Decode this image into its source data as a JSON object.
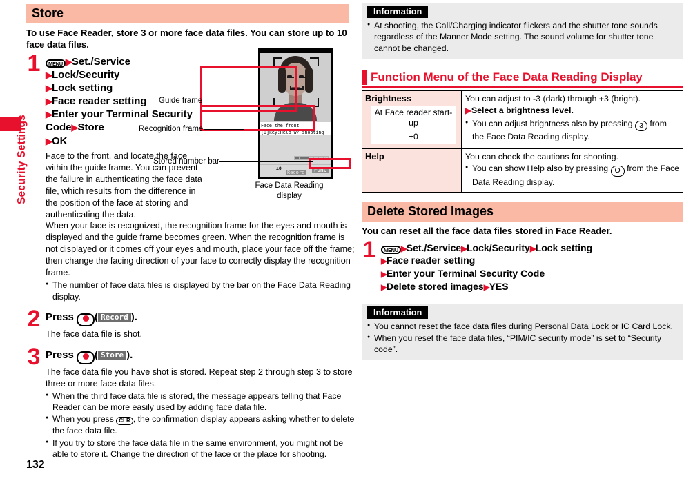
{
  "sidebar": {
    "chapter_label": "Security Settings"
  },
  "page": {
    "number": "132"
  },
  "left": {
    "section_title": "Store",
    "lead": "To use Face Reader, store 3 or more face data files. You can store up to 10 face data files.",
    "step1": {
      "num": "1",
      "menu_key": "MENU",
      "lines": [
        "Set./Service",
        "Lock/Security",
        "Lock setting",
        "Face reader setting",
        "Enter your Terminal Security Code",
        "Store",
        "OK"
      ],
      "body1": "Face to the front, and locate the face within the guide frame. You can prevent the failure in authenticating the face data file, which results from the difference in the position of the face at storing and authenticating the data.",
      "body2": "When your face is recognized, the recognition frame for the eyes and mouth is displayed and the guide frame becomes green. When the recognition frame is not displayed or it comes off your eyes and mouth, place your face off the frame; then change the facing direction of your face to correctly display the recognition frame.",
      "bullets": [
        "The number of face data files is displayed by the bar on the Face Data Reading display."
      ]
    },
    "step2": {
      "num": "2",
      "press_label": "Press",
      "softkey": "Record",
      "period": ").",
      "open_paren": "(",
      "body": "The face data file is shot."
    },
    "step3": {
      "num": "3",
      "press_label": "Press",
      "softkey": "Store",
      "body": "The face data file you have shot is stored. Repeat step 2 through step 3 to store three or more face data files.",
      "bullets": [
        "When the third face data file is stored, the message appears telling that Face Reader can be more easily used by adding face data file.",
        "When you press CLR , the confirmation display appears asking whether to delete the face data file.",
        "If you try to store the face data file in the same environment, you might not be able to store it. Change the direction of the face or the place for shooting."
      ],
      "bullet2_pre": "When you press",
      "bullet2_key": "CLR",
      "bullet2_post": ", the confirmation display appears asking whether to delete the face data file."
    },
    "figure": {
      "caption": "Face Data Reading display",
      "callouts": {
        "guide_frame": "Guide frame",
        "recognition_frame": "Recognition frame",
        "stored_number_bar": "Stored number bar"
      },
      "screen": {
        "line1": "Face the front",
        "line2": "[0]key:Help w/ shooting",
        "brightness": "±0",
        "record_softkey": "Record",
        "func_softkey": "FUNC",
        "stored_segments_filled": 3,
        "stored_segments_total": 10
      }
    }
  },
  "right": {
    "info_top": {
      "header": "Information",
      "bullets": [
        "At shooting, the Call/Charging indicator flickers and the shutter tone sounds regardless of the Manner Mode setting. The sound volume for shutter tone cannot be changed."
      ]
    },
    "function_menu": {
      "heading": "Function Menu of the Face Data Reading Display",
      "rows": [
        {
          "label": "Brightness",
          "default_title": "At Face reader start-up",
          "default_value": "±0",
          "desc_line1": "You can adjust to -3 (dark) through +3 (bright).",
          "sub_action": "Select a brightness level.",
          "bullet_pre": "You can adjust brightness also by pressing",
          "bullet_key": "3",
          "bullet_post": "from the Face Data Reading display."
        },
        {
          "label": "Help",
          "default_title": "",
          "default_value": "",
          "desc_line1": "You can check the cautions for shooting.",
          "sub_action": "",
          "bullet_pre": "You can show Help also by pressing",
          "bullet_key": "O",
          "bullet_post": "from the Face Data Reading display."
        }
      ]
    },
    "delete_section": {
      "section_title": "Delete Stored Images",
      "lead": "You can reset all the face data files stored in Face Reader.",
      "step1": {
        "num": "1",
        "menu_key": "MENU",
        "lines": [
          "Set./Service",
          "Lock/Security",
          "Lock setting",
          "Face reader setting",
          "Enter your Terminal Security Code",
          "Delete stored images",
          "YES"
        ]
      }
    },
    "info_bottom": {
      "header": "Information",
      "bullets": [
        "You cannot reset the face data files during Personal Data Lock or IC Card Lock.",
        "When you reset the face data files, “PIM/IC security mode” is set to “Security code”."
      ]
    }
  },
  "colors": {
    "accent_red": "#e8112d",
    "band_peach": "#fab9a4",
    "table_label_pink": "#fbe2dc",
    "info_gray": "#ebebeb"
  }
}
